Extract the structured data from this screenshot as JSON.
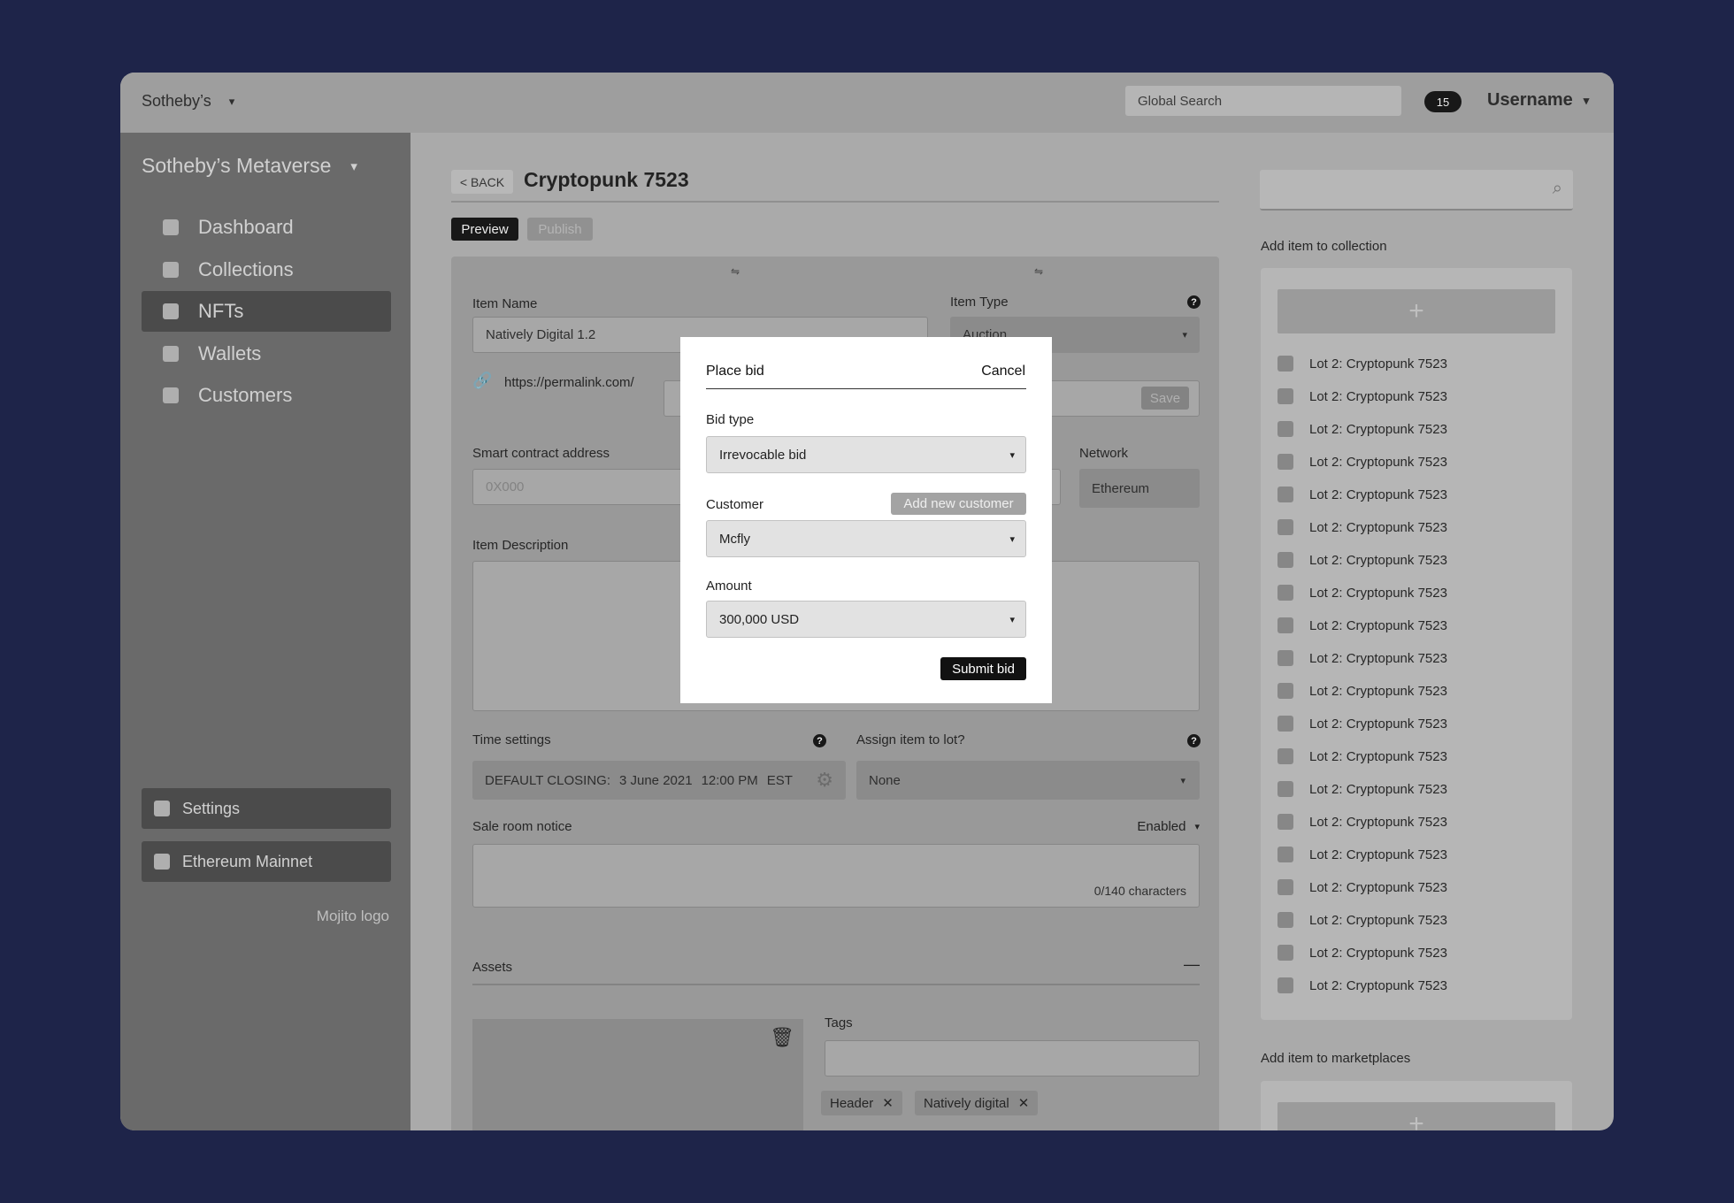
{
  "topbar": {
    "org": "Sotheby’s",
    "search_placeholder": "Global Search",
    "notifications": "15",
    "username": "Username"
  },
  "sidebar": {
    "site": "Sotheby’s Metaverse",
    "items": [
      {
        "label": "Dashboard",
        "active": false
      },
      {
        "label": "Collections",
        "active": false
      },
      {
        "label": "NFTs",
        "active": true
      },
      {
        "label": "Wallets",
        "active": false
      },
      {
        "label": "Customers",
        "active": false
      }
    ],
    "settings": "Settings",
    "network": "Ethereum Mainnet",
    "logo": "Mojito logo"
  },
  "main": {
    "back": "< BACK",
    "title": "Cryptopunk 7523",
    "preview": "Preview",
    "publish": "Publish",
    "item_name_label": "Item Name",
    "item_name": "Natively Digital 1.2",
    "item_type_label": "Item Type",
    "item_type": "Auction",
    "permalink": "https://permalink.com/",
    "save": "Save",
    "contract_label": "Smart contract address",
    "contract_placeholder": "0X000",
    "network_label": "Network",
    "network_value": "Ethereum",
    "desc_label": "Item Description",
    "time_label": "Time settings",
    "time_prefix": "DEFAULT CLOSING:",
    "time_date": "3 June 2021",
    "time_time": "12:00 PM",
    "time_zone": "EST",
    "lot_label": "Assign item to lot?",
    "lot_value": "None",
    "notice_label": "Sale room notice",
    "notice_state": "Enabled",
    "notice_counter": "0/140 characters",
    "assets_label": "Assets",
    "tags_label": "Tags",
    "tags": [
      "Header",
      "Natively digital"
    ]
  },
  "right": {
    "collection_label": "Add item to collection",
    "lots": [
      "Lot 2: Cryptopunk 7523",
      "Lot 2: Cryptopunk 7523",
      "Lot 2: Cryptopunk 7523",
      "Lot 2: Cryptopunk 7523",
      "Lot 2: Cryptopunk 7523",
      "Lot 2: Cryptopunk 7523",
      "Lot 2: Cryptopunk 7523",
      "Lot 2: Cryptopunk 7523",
      "Lot 2: Cryptopunk 7523",
      "Lot 2: Cryptopunk 7523",
      "Lot 2: Cryptopunk 7523",
      "Lot 2: Cryptopunk 7523",
      "Lot 2: Cryptopunk 7523",
      "Lot 2: Cryptopunk 7523",
      "Lot 2: Cryptopunk 7523",
      "Lot 2: Cryptopunk 7523",
      "Lot 2: Cryptopunk 7523",
      "Lot 2: Cryptopunk 7523",
      "Lot 2: Cryptopunk 7523",
      "Lot 2: Cryptopunk 7523"
    ],
    "marketplaces_label": "Add item to marketplaces"
  },
  "modal": {
    "title": "Place bid",
    "cancel": "Cancel",
    "bid_type_label": "Bid type",
    "bid_type": "Irrevocable bid",
    "customer_label": "Customer",
    "add_customer": "Add new customer",
    "customer": "Mcfly",
    "amount_label": "Amount",
    "amount": "300,000 USD",
    "submit": "Submit bid"
  },
  "icons": {
    "caret": "▾",
    "delete": "✕",
    "plus": "+"
  }
}
